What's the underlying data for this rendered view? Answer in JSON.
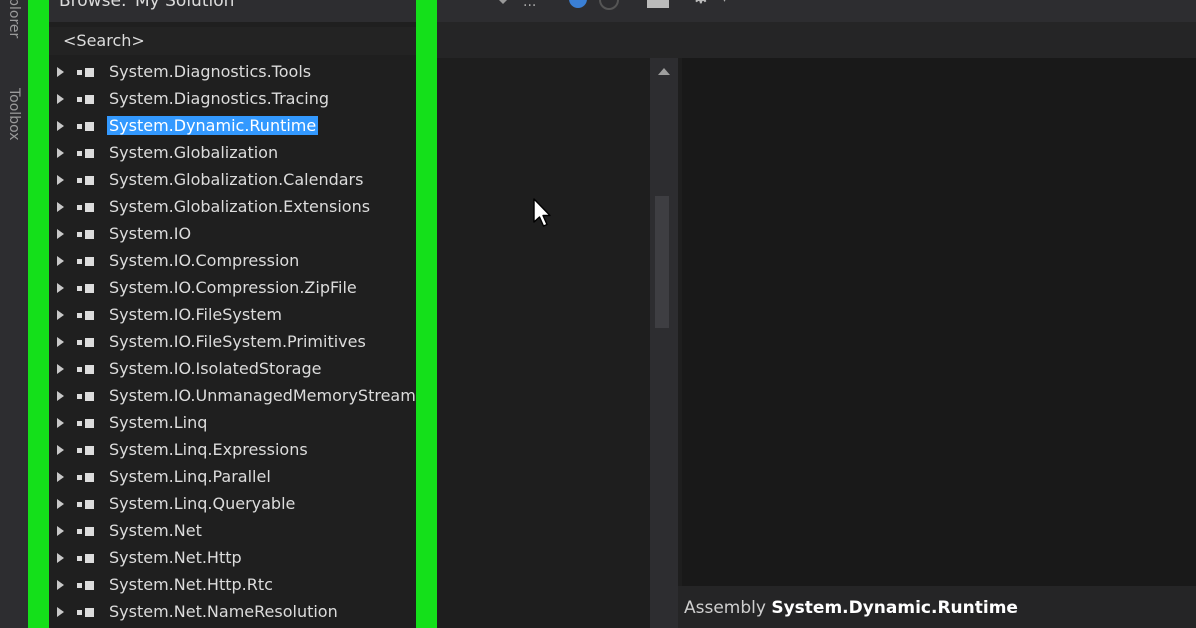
{
  "rail": {
    "label_a": "Explorer",
    "label_b": "Toolbox"
  },
  "browse": {
    "label": "Browse:",
    "value": "My Solution"
  },
  "toolbar": {
    "dots": "...",
    "gear_arrow": "▾"
  },
  "search": {
    "placeholder": "<Search>"
  },
  "tree": {
    "items": [
      "System.Diagnostics.Tools",
      "System.Diagnostics.Tracing",
      "System.Dynamic.Runtime",
      "System.Globalization",
      "System.Globalization.Calendars",
      "System.Globalization.Extensions",
      "System.IO",
      "System.IO.Compression",
      "System.IO.Compression.ZipFile",
      "System.IO.FileSystem",
      "System.IO.FileSystem.Primitives",
      "System.IO.IsolatedStorage",
      "System.IO.UnmanagedMemoryStream",
      "System.Linq",
      "System.Linq.Expressions",
      "System.Linq.Parallel",
      "System.Linq.Queryable",
      "System.Net",
      "System.Net.Http",
      "System.Net.Http.Rtc",
      "System.Net.NameResolution"
    ],
    "selected": "System.Dynamic.Runtime"
  },
  "details": {
    "keyword": "Assembly",
    "name": "System.Dynamic.Runtime"
  },
  "colors": {
    "accent_green": "#14e01a",
    "selection": "#3399ff",
    "background": "#1e1e1e"
  }
}
